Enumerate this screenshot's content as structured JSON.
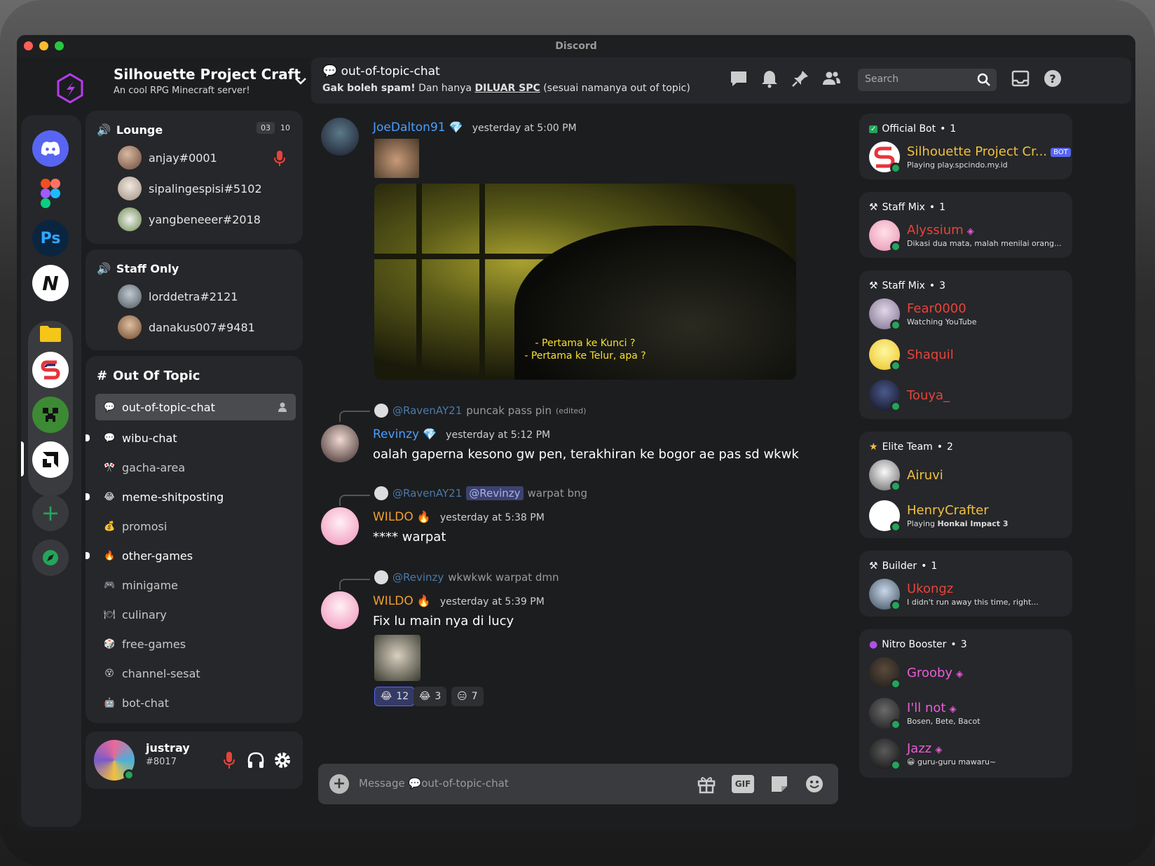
{
  "window": {
    "title": "Discord"
  },
  "server": {
    "name": "Silhouette Project Craft",
    "subtitle": "An cool RPG Minecraft server!"
  },
  "voice": [
    {
      "name": "Lounge",
      "counts": [
        "03",
        "10"
      ],
      "users": [
        "anjay#0001",
        "sipalingespisi#5102",
        "yangbeneeer#2018"
      ]
    },
    {
      "name": "Staff Only",
      "users": [
        "lorddetra#2121",
        "danakus007#9481"
      ]
    }
  ],
  "category": {
    "name": "Out Of Topic"
  },
  "channels": [
    {
      "name": "out-of-topic-chat",
      "icon": "💬"
    },
    {
      "name": "wibu-chat",
      "icon": "💬"
    },
    {
      "name": "gacha-area",
      "icon": "🎌"
    },
    {
      "name": "meme-shitposting",
      "icon": "😂"
    },
    {
      "name": "promosi",
      "icon": "💰"
    },
    {
      "name": "other-games",
      "icon": "🔥"
    },
    {
      "name": "minigame",
      "icon": "🎮"
    },
    {
      "name": "culinary",
      "icon": "🍽"
    },
    {
      "name": "free-games",
      "icon": "🎲"
    },
    {
      "name": "channel-sesat",
      "icon": "😵"
    },
    {
      "name": "bot-chat",
      "icon": "🤖"
    }
  ],
  "user": {
    "name": "justray",
    "tag": "#8017"
  },
  "chat": {
    "channel": "out-of-topic-chat",
    "topic_bold": "Gak boleh spam!",
    "topic_mid": " Dan hanya ",
    "topic_link": "DILUAR SPC",
    "topic_end": " (sesuai namanya out of topic)",
    "search_placeholder": "Search",
    "composer_prefix": "Message",
    "composer_channel": "out-of-topic-chat"
  },
  "messages": {
    "m1": {
      "author": "JoeDalton91",
      "time": "yesterday at 5:00 PM",
      "subtitle_1": "- Pertama ke Kunci ?",
      "subtitle_2": "- Pertama ke Telur, apa ?"
    },
    "m2": {
      "reply_to": "@RavenAY21",
      "reply_text": "puncak pass pin",
      "reply_edited": "(edited)",
      "author": "Revinzy",
      "time": "yesterday at 5:12 PM",
      "text": "oalah gaperna kesono gw pen, terakhiran ke bogor ae pas sd wkwk"
    },
    "m3": {
      "reply_to": "@RavenAY21",
      "reply_mention": "@Revinzy",
      "reply_text": "warpat bng",
      "author": "WILDO",
      "time": "yesterday at 5:38 PM",
      "text": "**** warpat"
    },
    "m4": {
      "reply_to": "@Revinzy",
      "reply_text": "wkwkwk warpat dmn",
      "author": "WILDO",
      "time": "yesterday at 5:39 PM",
      "text": "Fix lu main nya di lucy",
      "reactions": [
        {
          "emoji": "😂",
          "count": "12"
        },
        {
          "emoji": "😂",
          "count": "3"
        },
        {
          "emoji": "😑",
          "count": "7"
        }
      ]
    }
  },
  "members": [
    {
      "title": "Official Bot",
      "count": "1",
      "items": [
        {
          "name": "Silhouette Project Cr...",
          "tag": "BOT",
          "status_prefix": "Playing ",
          "status": "play.spcindo.my.id"
        }
      ]
    },
    {
      "title": "Staff Mix",
      "count": "1",
      "items": [
        {
          "name": "Alyssium",
          "status": "Dikasi dua mata, malah menilai orang..."
        }
      ]
    },
    {
      "title": "Staff Mix",
      "count": "3",
      "items": [
        {
          "name": "Fear0000",
          "status": "Watching YouTube"
        },
        {
          "name": "Shaquil"
        },
        {
          "name": "Touya_"
        }
      ]
    },
    {
      "title": "Elite Team",
      "count": "2",
      "items": [
        {
          "name": "Airuvi"
        },
        {
          "name": "HenryCrafter",
          "status_prefix": "Playing ",
          "status": "Honkai Impact 3"
        }
      ]
    },
    {
      "title": "Builder",
      "count": "1",
      "items": [
        {
          "name": "Ukongz",
          "status": "I didn't run away this time, right..."
        }
      ]
    },
    {
      "title": "Nitro Booster",
      "count": "3",
      "items": [
        {
          "name": "Grooby"
        },
        {
          "name": "I'll not",
          "status": "Bosen, Bete, Bacot"
        },
        {
          "name": "Jazz",
          "status": "guru-guru mawaru~"
        }
      ]
    }
  ],
  "colors": {
    "accent": "#5865f2",
    "online": "#23a55a",
    "blue_name": "#4a9eff",
    "orange_name": "#f0a030",
    "red_name": "#e8433a",
    "pink_name": "#e85dd8",
    "yellow_name": "#f0c040"
  }
}
